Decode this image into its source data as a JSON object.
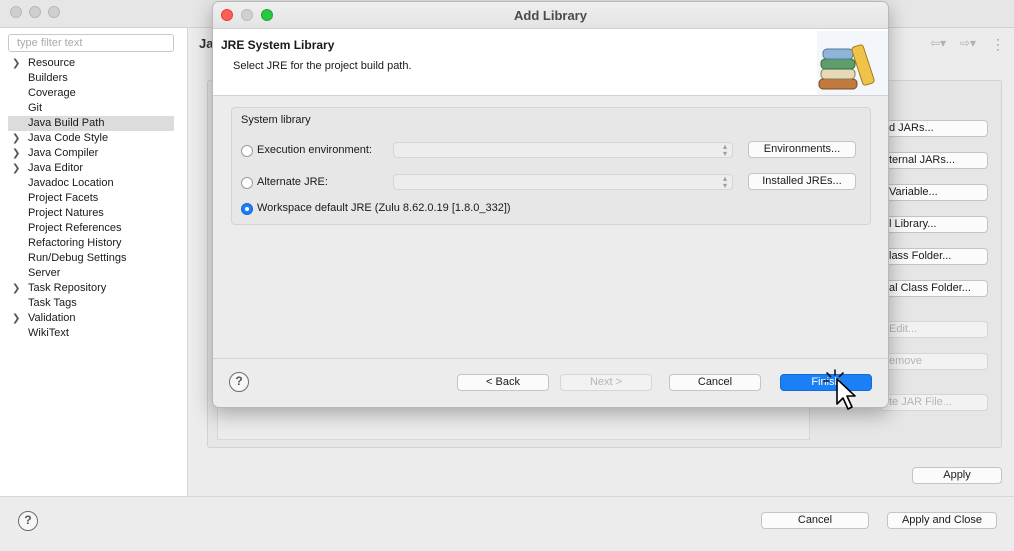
{
  "filter": {
    "placeholder": "type filter text"
  },
  "tree": [
    {
      "label": "Resource",
      "expandable": true
    },
    {
      "label": "Builders",
      "expandable": false
    },
    {
      "label": "Coverage",
      "expandable": false
    },
    {
      "label": "Git",
      "expandable": false
    },
    {
      "label": "Java Build Path",
      "expandable": false,
      "selected": true
    },
    {
      "label": "Java Code Style",
      "expandable": true
    },
    {
      "label": "Java Compiler",
      "expandable": true
    },
    {
      "label": "Java Editor",
      "expandable": true
    },
    {
      "label": "Javadoc Location",
      "expandable": false
    },
    {
      "label": "Project Facets",
      "expandable": false
    },
    {
      "label": "Project Natures",
      "expandable": false
    },
    {
      "label": "Project References",
      "expandable": false
    },
    {
      "label": "Refactoring History",
      "expandable": false
    },
    {
      "label": "Run/Debug Settings",
      "expandable": false
    },
    {
      "label": "Server",
      "expandable": false
    },
    {
      "label": "Task Repository",
      "expandable": true
    },
    {
      "label": "Task Tags",
      "expandable": false
    },
    {
      "label": "Validation",
      "expandable": true
    },
    {
      "label": "WikiText",
      "expandable": false
    }
  ],
  "page": {
    "title_fragment": "Ja",
    "buttons": {
      "add_jars": "d JARs...",
      "add_external_jars": "ternal JARs...",
      "add_variable": "Variable...",
      "add_library": "l Library...",
      "add_class_folder": "lass Folder...",
      "add_external_class_folder": "al Class Folder...",
      "edit": "Edit...",
      "remove": "emove",
      "migrate_jar": "te JAR File..."
    },
    "apply": "Apply"
  },
  "bottom": {
    "help": "?",
    "cancel": "Cancel",
    "apply_close": "Apply and Close"
  },
  "dialog": {
    "title": "Add Library",
    "header_title": "JRE System Library",
    "header_subtitle": "Select JRE for the project build path.",
    "group_label": "System library",
    "options": {
      "execution_env": {
        "label": "Execution environment:",
        "button": "Environments...",
        "checked": false
      },
      "alternate_jre": {
        "label": "Alternate JRE:",
        "button": "Installed JREs...",
        "checked": false
      },
      "workspace_default": {
        "label": "Workspace default JRE (Zulu 8.62.0.19 [1.8.0_332])",
        "checked": true
      }
    },
    "footer": {
      "help": "?",
      "back": "< Back",
      "next": "Next >",
      "cancel": "Cancel",
      "finish": "Finish"
    }
  },
  "colors": {
    "accent": "#1b7ff5",
    "selection": "#dcdcdc",
    "close": "#fd5f57",
    "minimize": "#d0d0d0",
    "zoom": "#28c840"
  },
  "icons": [
    "chevron-right-icon",
    "help-icon",
    "back-arrow-icon",
    "forward-arrow-icon",
    "kebab-menu-icon",
    "books-icon",
    "mouse-cursor-icon",
    "dropdown-arrow-icon"
  ]
}
